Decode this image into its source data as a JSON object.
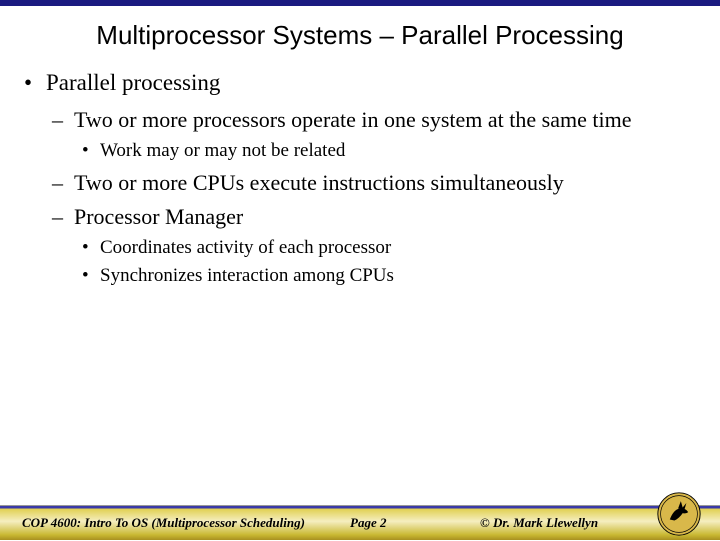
{
  "title": "Multiprocessor Systems – Parallel Processing",
  "bullets": {
    "b1": "Parallel processing",
    "b1_1": "Two or more processors operate in one system at the same time",
    "b1_1_1": "Work may or may not be related",
    "b1_2": "Two or more CPUs execute instructions simultaneously",
    "b1_3": "Processor Manager",
    "b1_3_1": "Coordinates activity of each processor",
    "b1_3_2": "Synchronizes interaction among CPUs"
  },
  "footer": {
    "course": "COP 4600: Intro To OS  (Multiprocessor Scheduling)",
    "page": "Page 2",
    "copyright": "© Dr. Mark Llewellyn"
  }
}
